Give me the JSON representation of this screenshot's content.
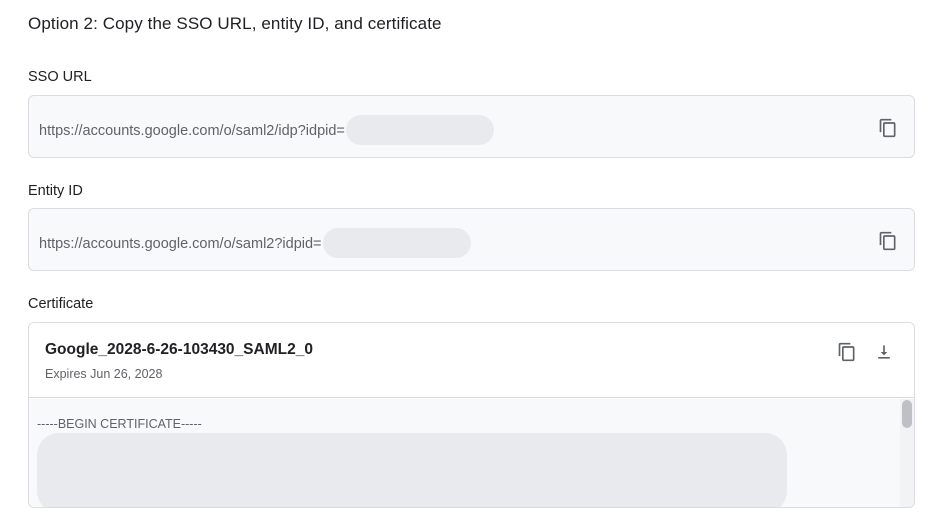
{
  "heading": "Option 2: Copy the SSO URL, entity ID, and certificate",
  "sso": {
    "label": "SSO URL",
    "value": "https://accounts.google.com/o/saml2/idp?idpid=",
    "copy_icon": "copy-icon"
  },
  "entity": {
    "label": "Entity ID",
    "value": "https://accounts.google.com/o/saml2?idpid=",
    "copy_icon": "copy-icon"
  },
  "certificate": {
    "label": "Certificate",
    "name": "Google_2028-6-26-103430_SAML2_0",
    "expires": "Expires Jun 26, 2028",
    "begin_line": "-----BEGIN CERTIFICATE-----",
    "copy_icon": "copy-icon",
    "download_icon": "download-icon"
  },
  "colors": {
    "border": "#dadce0",
    "field_bg": "#f8f9fa",
    "redaction": "#e8eaed",
    "icon": "#5f6368"
  }
}
